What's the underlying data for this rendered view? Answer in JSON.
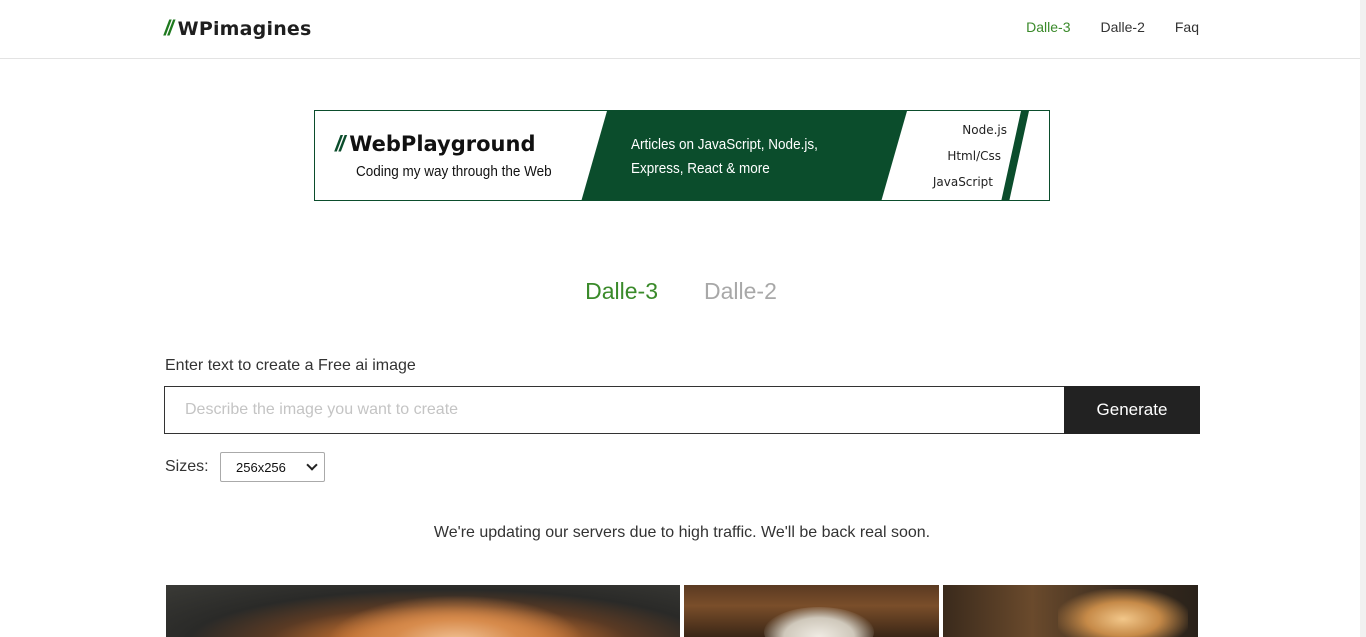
{
  "header": {
    "logo_slashes": "//",
    "logo_text": "WPimagines",
    "nav": [
      {
        "label": "Dalle-3",
        "active": true
      },
      {
        "label": "Dalle-2",
        "active": false
      },
      {
        "label": "Faq",
        "active": false
      }
    ]
  },
  "banner": {
    "slashes": "//",
    "title": "WebPlayground",
    "tagline": "Coding my way through the Web",
    "copy": "Articles on JavaScript, Node.js, Express, React & more",
    "tags": [
      "Node.js",
      "Html/Css",
      "JavaScript"
    ]
  },
  "model_tabs": [
    {
      "label": "Dalle-3",
      "active": true
    },
    {
      "label": "Dalle-2",
      "active": false
    }
  ],
  "form": {
    "prompt_label": "Enter text to create a Free ai image",
    "prompt_placeholder": "Describe the image you want to create",
    "prompt_value": "",
    "generate_label": "Generate",
    "sizes_label": "Sizes:",
    "sizes_value": "256x256"
  },
  "notice": "We're updating our servers due to high traffic. We'll be back real soon.",
  "colors": {
    "accent": "#3a8a2a",
    "banner_green": "#0b4d2c",
    "button_dark": "#222222"
  }
}
